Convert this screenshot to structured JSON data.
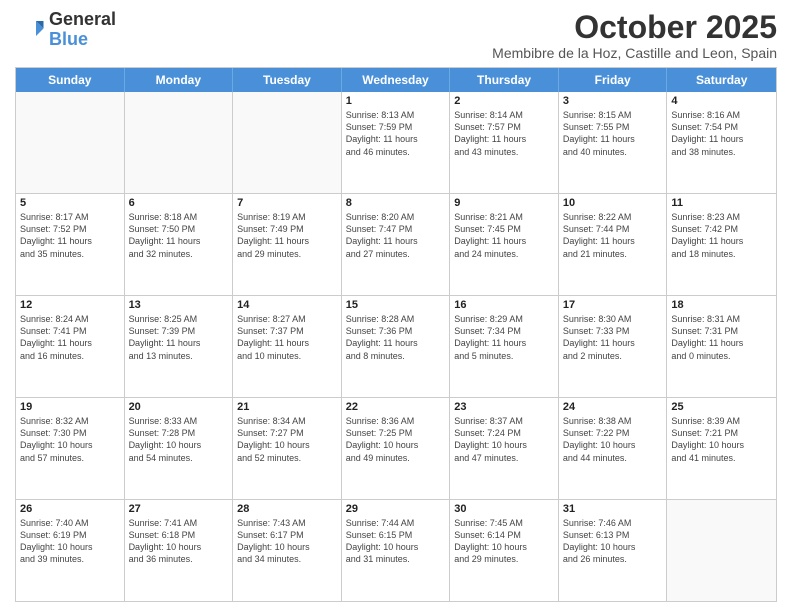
{
  "logo": {
    "line1": "General",
    "line2": "Blue"
  },
  "title": "October 2025",
  "subtitle": "Membibre de la Hoz, Castille and Leon, Spain",
  "header_days": [
    "Sunday",
    "Monday",
    "Tuesday",
    "Wednesday",
    "Thursday",
    "Friday",
    "Saturday"
  ],
  "rows": [
    [
      {
        "day": "",
        "text": ""
      },
      {
        "day": "",
        "text": ""
      },
      {
        "day": "",
        "text": ""
      },
      {
        "day": "1",
        "text": "Sunrise: 8:13 AM\nSunset: 7:59 PM\nDaylight: 11 hours\nand 46 minutes."
      },
      {
        "day": "2",
        "text": "Sunrise: 8:14 AM\nSunset: 7:57 PM\nDaylight: 11 hours\nand 43 minutes."
      },
      {
        "day": "3",
        "text": "Sunrise: 8:15 AM\nSunset: 7:55 PM\nDaylight: 11 hours\nand 40 minutes."
      },
      {
        "day": "4",
        "text": "Sunrise: 8:16 AM\nSunset: 7:54 PM\nDaylight: 11 hours\nand 38 minutes."
      }
    ],
    [
      {
        "day": "5",
        "text": "Sunrise: 8:17 AM\nSunset: 7:52 PM\nDaylight: 11 hours\nand 35 minutes."
      },
      {
        "day": "6",
        "text": "Sunrise: 8:18 AM\nSunset: 7:50 PM\nDaylight: 11 hours\nand 32 minutes."
      },
      {
        "day": "7",
        "text": "Sunrise: 8:19 AM\nSunset: 7:49 PM\nDaylight: 11 hours\nand 29 minutes."
      },
      {
        "day": "8",
        "text": "Sunrise: 8:20 AM\nSunset: 7:47 PM\nDaylight: 11 hours\nand 27 minutes."
      },
      {
        "day": "9",
        "text": "Sunrise: 8:21 AM\nSunset: 7:45 PM\nDaylight: 11 hours\nand 24 minutes."
      },
      {
        "day": "10",
        "text": "Sunrise: 8:22 AM\nSunset: 7:44 PM\nDaylight: 11 hours\nand 21 minutes."
      },
      {
        "day": "11",
        "text": "Sunrise: 8:23 AM\nSunset: 7:42 PM\nDaylight: 11 hours\nand 18 minutes."
      }
    ],
    [
      {
        "day": "12",
        "text": "Sunrise: 8:24 AM\nSunset: 7:41 PM\nDaylight: 11 hours\nand 16 minutes."
      },
      {
        "day": "13",
        "text": "Sunrise: 8:25 AM\nSunset: 7:39 PM\nDaylight: 11 hours\nand 13 minutes."
      },
      {
        "day": "14",
        "text": "Sunrise: 8:27 AM\nSunset: 7:37 PM\nDaylight: 11 hours\nand 10 minutes."
      },
      {
        "day": "15",
        "text": "Sunrise: 8:28 AM\nSunset: 7:36 PM\nDaylight: 11 hours\nand 8 minutes."
      },
      {
        "day": "16",
        "text": "Sunrise: 8:29 AM\nSunset: 7:34 PM\nDaylight: 11 hours\nand 5 minutes."
      },
      {
        "day": "17",
        "text": "Sunrise: 8:30 AM\nSunset: 7:33 PM\nDaylight: 11 hours\nand 2 minutes."
      },
      {
        "day": "18",
        "text": "Sunrise: 8:31 AM\nSunset: 7:31 PM\nDaylight: 11 hours\nand 0 minutes."
      }
    ],
    [
      {
        "day": "19",
        "text": "Sunrise: 8:32 AM\nSunset: 7:30 PM\nDaylight: 10 hours\nand 57 minutes."
      },
      {
        "day": "20",
        "text": "Sunrise: 8:33 AM\nSunset: 7:28 PM\nDaylight: 10 hours\nand 54 minutes."
      },
      {
        "day": "21",
        "text": "Sunrise: 8:34 AM\nSunset: 7:27 PM\nDaylight: 10 hours\nand 52 minutes."
      },
      {
        "day": "22",
        "text": "Sunrise: 8:36 AM\nSunset: 7:25 PM\nDaylight: 10 hours\nand 49 minutes."
      },
      {
        "day": "23",
        "text": "Sunrise: 8:37 AM\nSunset: 7:24 PM\nDaylight: 10 hours\nand 47 minutes."
      },
      {
        "day": "24",
        "text": "Sunrise: 8:38 AM\nSunset: 7:22 PM\nDaylight: 10 hours\nand 44 minutes."
      },
      {
        "day": "25",
        "text": "Sunrise: 8:39 AM\nSunset: 7:21 PM\nDaylight: 10 hours\nand 41 minutes."
      }
    ],
    [
      {
        "day": "26",
        "text": "Sunrise: 7:40 AM\nSunset: 6:19 PM\nDaylight: 10 hours\nand 39 minutes."
      },
      {
        "day": "27",
        "text": "Sunrise: 7:41 AM\nSunset: 6:18 PM\nDaylight: 10 hours\nand 36 minutes."
      },
      {
        "day": "28",
        "text": "Sunrise: 7:43 AM\nSunset: 6:17 PM\nDaylight: 10 hours\nand 34 minutes."
      },
      {
        "day": "29",
        "text": "Sunrise: 7:44 AM\nSunset: 6:15 PM\nDaylight: 10 hours\nand 31 minutes."
      },
      {
        "day": "30",
        "text": "Sunrise: 7:45 AM\nSunset: 6:14 PM\nDaylight: 10 hours\nand 29 minutes."
      },
      {
        "day": "31",
        "text": "Sunrise: 7:46 AM\nSunset: 6:13 PM\nDaylight: 10 hours\nand 26 minutes."
      },
      {
        "day": "",
        "text": ""
      }
    ]
  ]
}
